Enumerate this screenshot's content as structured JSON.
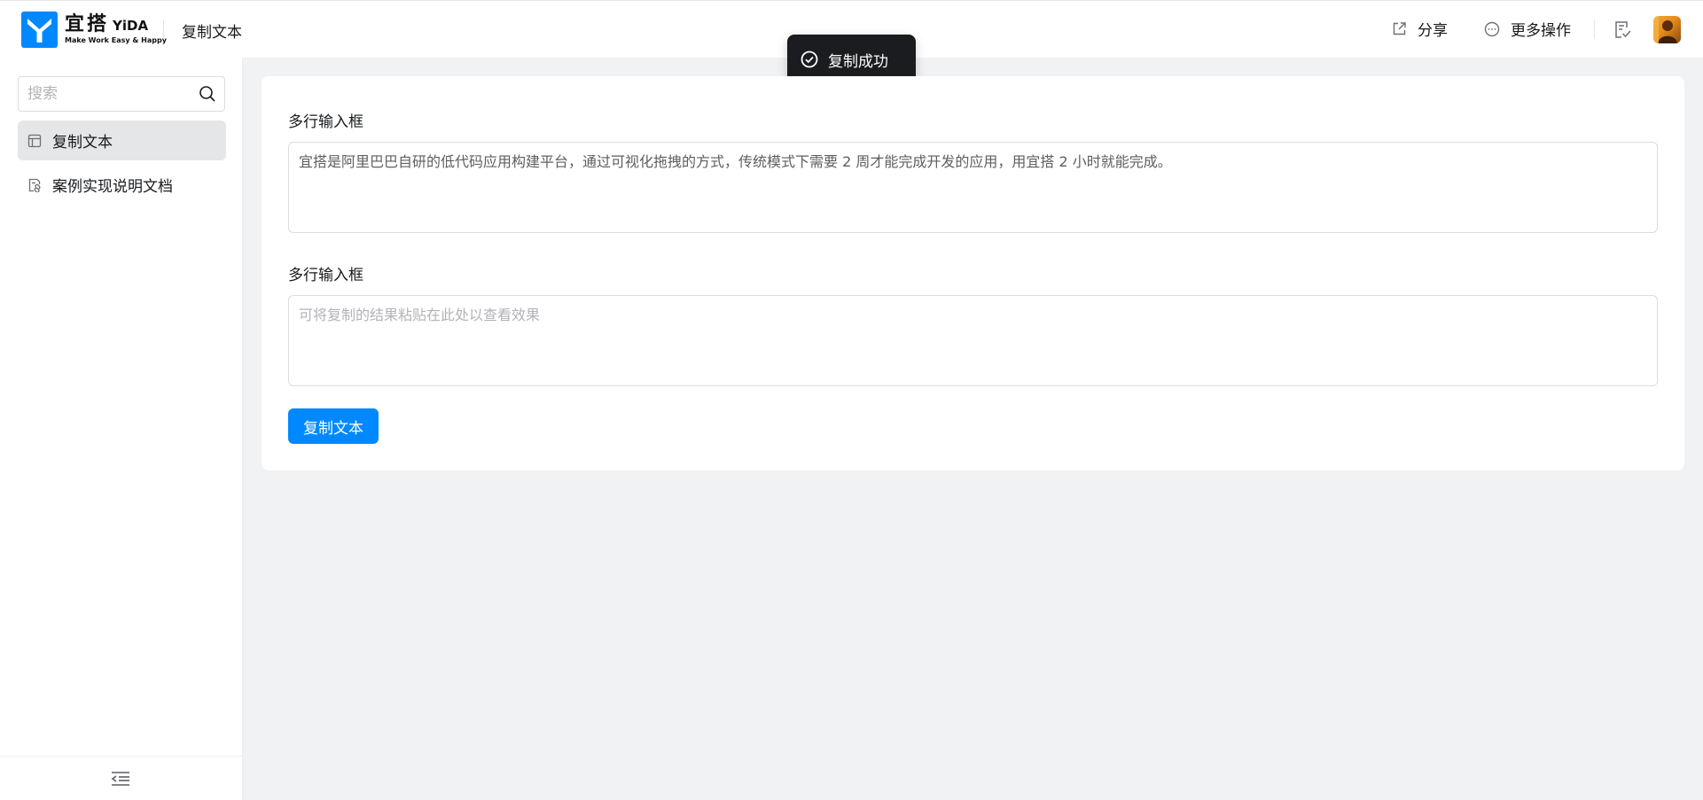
{
  "header": {
    "logo_cn": "宜搭",
    "logo_en": "YiDA",
    "logo_slogan": "Make Work Easy & Happy",
    "title": "复制文本",
    "share_label": "分享",
    "more_label": "更多操作",
    "brand_color": "#0089ff"
  },
  "toast": {
    "message": "复制成功",
    "icon": "check-circle-icon"
  },
  "sidebar": {
    "search_placeholder": "搜索",
    "items": [
      {
        "label": "复制文本",
        "icon": "form-icon",
        "active": true
      },
      {
        "label": "案例实现说明文档",
        "icon": "doc-link-icon",
        "active": false
      }
    ],
    "footer_icon": "collapse-menu-icon"
  },
  "main": {
    "field1": {
      "label": "多行输入框",
      "value": "宜搭是阿里巴巴自研的低代码应用构建平台，通过可视化拖拽的方式，传统模式下需要 2 周才能完成开发的应用，用宜搭 2 小时就能完成。"
    },
    "field2": {
      "label": "多行输入框",
      "placeholder": "可将复制的结果粘贴在此处以查看效果"
    },
    "copy_button_label": "复制文本"
  }
}
